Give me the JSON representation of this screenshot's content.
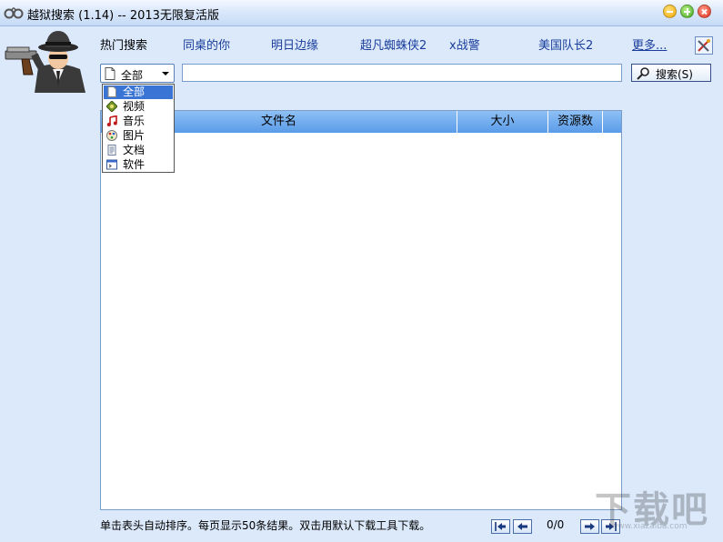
{
  "window": {
    "title": "越狱搜索 (1.14) -- 2013无限复活版"
  },
  "hot_search": {
    "label": "热门搜索",
    "links": [
      "同桌的你",
      "明日边缘",
      "超凡蜘蛛侠2",
      "x战警",
      "美国队长2"
    ],
    "more": "更多..."
  },
  "search": {
    "category_value": "全部",
    "query": "",
    "button_label": "搜索(S)"
  },
  "category_dropdown": {
    "options": [
      {
        "label": "全部",
        "icon": "document-icon",
        "selected": true
      },
      {
        "label": "视频",
        "icon": "video-icon",
        "selected": false
      },
      {
        "label": "音乐",
        "icon": "music-note-icon",
        "selected": false
      },
      {
        "label": "图片",
        "icon": "picture-icon",
        "selected": false
      },
      {
        "label": "文档",
        "icon": "text-document-icon",
        "selected": false
      },
      {
        "label": "软件",
        "icon": "software-icon",
        "selected": false
      }
    ]
  },
  "results": {
    "columns": [
      "文件名",
      "大小",
      "资源数"
    ],
    "rows": []
  },
  "status": {
    "text": "单击表头自动排序。每页显示50条结果。双击用默认下载工具下载。",
    "page": "0/0"
  },
  "watermark": {
    "text": "下载吧",
    "url": "www.xiazaiba.com"
  },
  "colors": {
    "window_bg": "#dbe9fb",
    "header_blue": "#5a9be8",
    "link_blue": "#1a3d9b",
    "selection_blue": "#3a75d6"
  }
}
